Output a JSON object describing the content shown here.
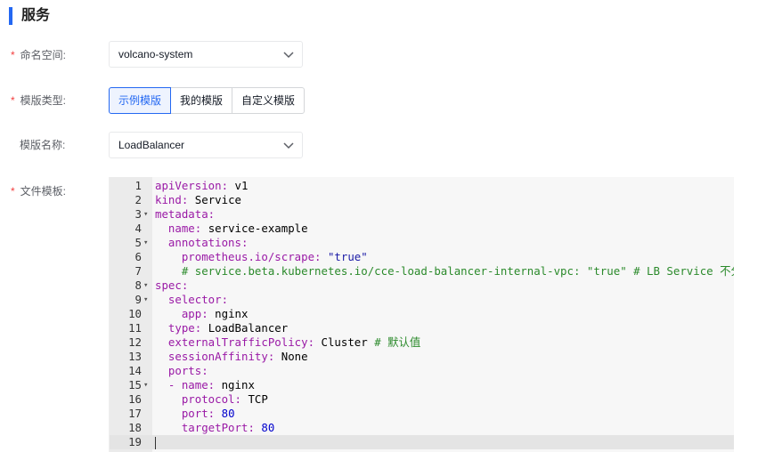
{
  "section": {
    "title": "服务"
  },
  "form": {
    "namespace": {
      "label": "命名空间:",
      "required": true,
      "value": "volcano-system"
    },
    "template_type": {
      "label": "模版类型:",
      "required": true,
      "options": [
        "示例模版",
        "我的模版",
        "自定义模版"
      ],
      "selected_index": 0
    },
    "template_name": {
      "label": "模版名称:",
      "required": false,
      "value": "LoadBalancer"
    },
    "file_template": {
      "label": "文件模板:",
      "required": true
    }
  },
  "editor": {
    "lines": [
      {
        "n": "1",
        "fold": false,
        "indent": "",
        "key": "apiVersion:",
        "val": " v1",
        "valType": "v",
        "comment": ""
      },
      {
        "n": "2",
        "fold": false,
        "indent": "",
        "key": "kind:",
        "val": " Service",
        "valType": "v",
        "comment": ""
      },
      {
        "n": "3",
        "fold": true,
        "indent": "",
        "key": "metadata:",
        "val": "",
        "valType": "v",
        "comment": ""
      },
      {
        "n": "4",
        "fold": false,
        "indent": "  ",
        "key": "name:",
        "val": " service-example",
        "valType": "v",
        "comment": ""
      },
      {
        "n": "5",
        "fold": true,
        "indent": "  ",
        "key": "annotations:",
        "val": "",
        "valType": "v",
        "comment": ""
      },
      {
        "n": "6",
        "fold": false,
        "indent": "    ",
        "key": "prometheus.io/scrape:",
        "val": " \"true\"",
        "valType": "s",
        "comment": ""
      },
      {
        "n": "7",
        "fold": false,
        "indent": "    ",
        "key": "",
        "val": "",
        "valType": "v",
        "comment": "# service.beta.kubernetes.io/cce-load-balancer-internal-vpc: \"true\" # LB Service 不分配"
      },
      {
        "n": "8",
        "fold": true,
        "indent": "",
        "key": "spec:",
        "val": "",
        "valType": "v",
        "comment": ""
      },
      {
        "n": "9",
        "fold": true,
        "indent": "  ",
        "key": "selector:",
        "val": "",
        "valType": "v",
        "comment": ""
      },
      {
        "n": "10",
        "fold": false,
        "indent": "    ",
        "key": "app:",
        "val": " nginx",
        "valType": "v",
        "comment": ""
      },
      {
        "n": "11",
        "fold": false,
        "indent": "  ",
        "key": "type:",
        "val": " LoadBalancer",
        "valType": "v",
        "comment": ""
      },
      {
        "n": "12",
        "fold": false,
        "indent": "  ",
        "key": "externalTrafficPolicy:",
        "val": " Cluster ",
        "valType": "v",
        "comment": "# 默认值"
      },
      {
        "n": "13",
        "fold": false,
        "indent": "  ",
        "key": "sessionAffinity:",
        "val": " None",
        "valType": "v",
        "comment": ""
      },
      {
        "n": "14",
        "fold": false,
        "indent": "  ",
        "key": "ports:",
        "val": "",
        "valType": "v",
        "comment": ""
      },
      {
        "n": "15",
        "fold": true,
        "indent": "  ",
        "key": "- name:",
        "val": " nginx",
        "valType": "v",
        "comment": ""
      },
      {
        "n": "16",
        "fold": false,
        "indent": "    ",
        "key": "protocol:",
        "val": " TCP",
        "valType": "v",
        "comment": ""
      },
      {
        "n": "17",
        "fold": false,
        "indent": "    ",
        "key": "port:",
        "val": " 80",
        "valType": "n",
        "comment": ""
      },
      {
        "n": "18",
        "fold": false,
        "indent": "    ",
        "key": "targetPort:",
        "val": " 80",
        "valType": "n",
        "comment": ""
      },
      {
        "n": "19",
        "fold": false,
        "indent": "",
        "key": "",
        "val": "",
        "valType": "v",
        "comment": "",
        "current": true
      }
    ]
  },
  "colors": {
    "accent": "#2468f2",
    "required": "#f33e3e"
  }
}
